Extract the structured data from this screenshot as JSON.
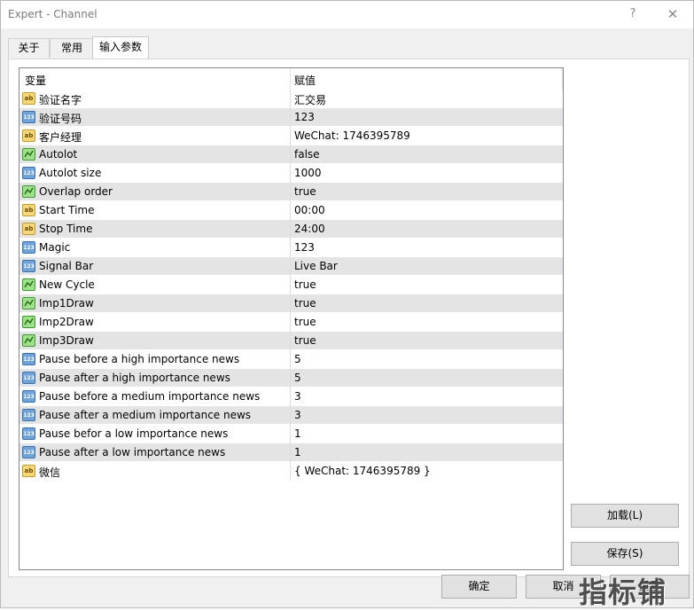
{
  "window": {
    "title": "Expert - Channel",
    "help_glyph": "?",
    "close_glyph": "✕"
  },
  "tabs": [
    {
      "label": "关于"
    },
    {
      "label": "常用"
    },
    {
      "label": "输入参数"
    }
  ],
  "grid": {
    "header_variable": "变量",
    "header_value": "赋值",
    "rows": [
      {
        "type": "ab",
        "name": "验证名字",
        "value": "汇交易"
      },
      {
        "type": "123",
        "name": "验证号码",
        "value": "123"
      },
      {
        "type": "ab",
        "name": "客户经理",
        "value": "WeChat:  1746395789"
      },
      {
        "type": "bool",
        "name": "Autolot",
        "value": "false"
      },
      {
        "type": "123",
        "name": "Autolot size",
        "value": "1000"
      },
      {
        "type": "bool",
        "name": "Overlap order",
        "value": "true"
      },
      {
        "type": "ab",
        "name": "Start Time",
        "value": "00:00"
      },
      {
        "type": "ab",
        "name": "Stop Time",
        "value": "24:00"
      },
      {
        "type": "123",
        "name": "Magic",
        "value": "123"
      },
      {
        "type": "123",
        "name": "Signal Bar",
        "value": "Live Bar"
      },
      {
        "type": "bool",
        "name": "New Cycle",
        "value": "true"
      },
      {
        "type": "bool",
        "name": "Imp1Draw",
        "value": "true"
      },
      {
        "type": "bool",
        "name": "Imp2Draw",
        "value": "true"
      },
      {
        "type": "bool",
        "name": "Imp3Draw",
        "value": "true"
      },
      {
        "type": "123",
        "name": "Pause before a high importance news",
        "value": "5"
      },
      {
        "type": "123",
        "name": "Pause after a high importance news",
        "value": "5"
      },
      {
        "type": "123",
        "name": "Pause before a medium importance news",
        "value": "3"
      },
      {
        "type": "123",
        "name": "Pause after a medium importance news",
        "value": "3"
      },
      {
        "type": "123",
        "name": "Pause befor a low importance news",
        "value": "1"
      },
      {
        "type": "123",
        "name": "Pause after a low importance news",
        "value": "1"
      },
      {
        "type": "ab",
        "name": "微信",
        "value": "{ WeChat:  1746395789 }"
      }
    ]
  },
  "buttons": {
    "load": "加载(L)",
    "save": "保存(S)",
    "ok": "确定",
    "cancel": "取消",
    "reset": "重置"
  },
  "watermark": "指标铺",
  "colors": {
    "row_alt": "#e4e4e4",
    "icon_ab": "#f6d77a",
    "icon_123": "#6ea3dc",
    "icon_bool": "#9fe08a"
  }
}
